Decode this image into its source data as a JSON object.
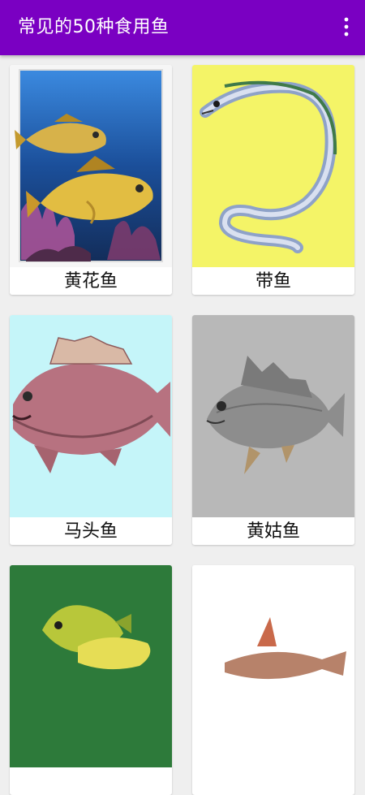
{
  "appbar": {
    "title": "常见的50种食用鱼",
    "background_color": "#7a00c2",
    "menu_icon": "more-vertical-icon"
  },
  "fish_list": [
    {
      "name": "黄花鱼",
      "background": "#1e5aa6"
    },
    {
      "name": "带鱼",
      "background": "#f4f467"
    },
    {
      "name": "马头鱼",
      "background": "#c5f5f9"
    },
    {
      "name": "黄姑鱼",
      "background": "#b8b8b8"
    },
    {
      "name": "",
      "background": "#2d7a3a"
    },
    {
      "name": "",
      "background": "#ffffff"
    }
  ]
}
